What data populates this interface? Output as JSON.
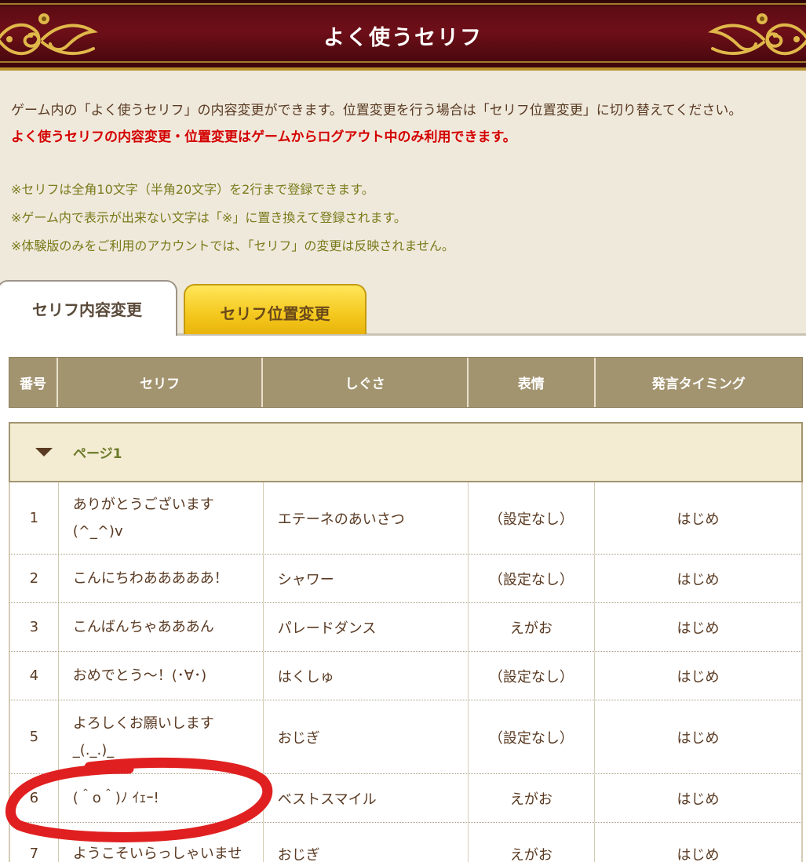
{
  "header": {
    "title": "よく使うセリフ"
  },
  "intro": {
    "text": "ゲーム内の「よく使うセリフ」の内容変更ができます。位置変更を行う場合は「セリフ位置変更」に切り替えてください。",
    "warning": "よく使うセリフの内容変更・位置変更はゲームからログアウト中のみ利用できます。",
    "notes": [
      "※セリフは全角10文字（半角20文字）を2行まで登録できます。",
      "※ゲーム内で表示が出来ない文字は「※」に置き換えて登録されます。",
      "※体験版のみをご利用のアカウントでは、「セリフ」の変更は反映されません。"
    ]
  },
  "tabs": {
    "active": "セリフ内容変更",
    "inactive": "セリフ位置変更"
  },
  "table": {
    "headers": [
      "番号",
      "セリフ",
      "しぐさ",
      "表情",
      "発言タイミング"
    ],
    "page_label": "ページ1",
    "rows": [
      {
        "num": "1",
        "serif": [
          "ありがとうございます",
          "(^_^)v"
        ],
        "action": "エテーネのあいさつ",
        "face": "（設定なし）",
        "timing": "はじめ"
      },
      {
        "num": "2",
        "serif": [
          "こんにちわあああああ！"
        ],
        "action": "シャワー",
        "face": "（設定なし）",
        "timing": "はじめ"
      },
      {
        "num": "3",
        "serif": [
          "こんばんちゃあああん"
        ],
        "action": "パレードダンス",
        "face": "えがお",
        "timing": "はじめ"
      },
      {
        "num": "4",
        "serif": [
          "おめでとう〜！(･∀･)"
        ],
        "action": "はくしゅ",
        "face": "（設定なし）",
        "timing": "はじめ"
      },
      {
        "num": "5",
        "serif": [
          "よろしくお願いします",
          "_(._.)_"
        ],
        "action": "おじぎ",
        "face": "（設定なし）",
        "timing": "はじめ"
      },
      {
        "num": "6",
        "serif": [
          "(＾o＾)ﾉ ｲｪｰ!"
        ],
        "action": "ベストスマイル",
        "face": "えがお",
        "timing": "はじめ"
      },
      {
        "num": "7",
        "serif": [
          "ようこそいらっしゃいませ"
        ],
        "action": "おじぎ",
        "face": "えがお",
        "timing": "はじめ"
      }
    ]
  },
  "colors": {
    "banner": "#6e0f18",
    "header_row": "#a39470",
    "warning": "#d40000",
    "note": "#7a7a1a",
    "tab_yellow": "#f4c81e",
    "annotation": "#e02020"
  },
  "icons": {
    "page_toggle": "triangle-down-icon",
    "ornament": "gold-scroll-ornament"
  }
}
